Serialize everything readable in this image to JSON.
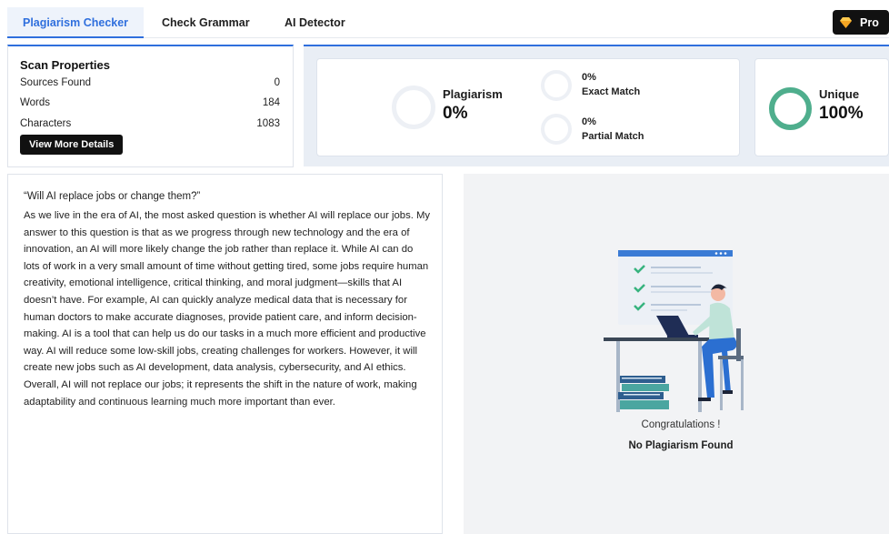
{
  "tabs": [
    {
      "label": "Plagiarism Checker",
      "active": true
    },
    {
      "label": "Check Grammar",
      "active": false
    },
    {
      "label": "AI Detector",
      "active": false
    }
  ],
  "pro_button": {
    "label": "Pro",
    "icon": "diamond-icon"
  },
  "scan_properties": {
    "title": "Scan Properties",
    "rows": [
      {
        "label": "Sources Found",
        "value": "0"
      },
      {
        "label": "Words",
        "value": "184"
      },
      {
        "label": "Characters",
        "value": "1083"
      }
    ],
    "details_button": "View More Details"
  },
  "stats": {
    "plagiarism_label": "Plagiarism",
    "plagiarism_value": "0%",
    "exact_match_value": "0%",
    "exact_match_label": "Exact Match",
    "partial_match_value": "0%",
    "partial_match_label": "Partial Match",
    "unique_label": "Unique",
    "unique_value": "100%"
  },
  "essay": {
    "title": "“Will AI replace jobs or change them?”",
    "body": "As we live in the era of AI, the most asked question is whether AI will replace our jobs. My answer to this question is that as we progress through new technology and the era of innovation, an AI will more likely change the job rather than replace it. While AI can do lots of work in a very small amount of time without getting tired, some jobs require human creativity, emotional intelligence, critical thinking, and moral judgment—skills that AI doesn’t have. For example, AI can quickly analyze medical data that is necessary for human doctors to make accurate diagnoses, provide patient care, and inform decision-making. AI is a tool that can help us do our tasks in a much more efficient and productive way. AI will reduce some low-skill jobs, creating challenges for workers. However, it will create new jobs such as AI development, data analysis, cybersecurity, and AI ethics. Overall, AI will not replace our jobs; it represents the shift in the nature of work, making adaptability and continuous learning much more important than ever."
  },
  "result": {
    "congrats": "Congratulations !",
    "message": "No Plagiarism Found"
  },
  "colors": {
    "accent": "#2f6fdd",
    "unique_ring": "#4fae8d",
    "pro_bg": "#111111"
  }
}
